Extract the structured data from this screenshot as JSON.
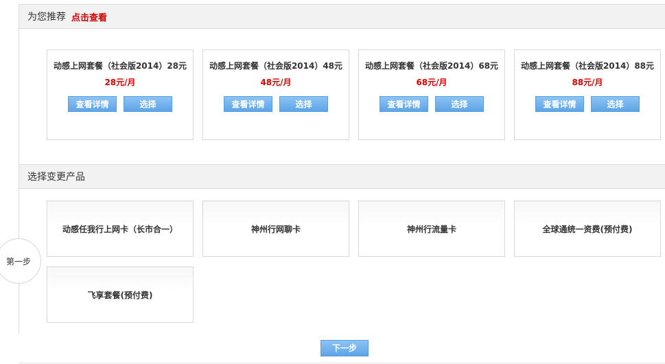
{
  "recommend": {
    "title": "为您推荐",
    "link": "点击查看",
    "plans": [
      {
        "name": "动感上网套餐（社会版2014）28元",
        "price": "28元/月",
        "detail": "查看详情",
        "select": "选择"
      },
      {
        "name": "动感上网套餐（社会版2014）48元",
        "price": "48元/月",
        "detail": "查看详情",
        "select": "选择"
      },
      {
        "name": "动感上网套餐（社会版2014）68元",
        "price": "68元/月",
        "detail": "查看详情",
        "select": "选择"
      },
      {
        "name": "动感上网套餐（社会版2014）88元",
        "price": "88元/月",
        "detail": "查看详情",
        "select": "选择"
      }
    ]
  },
  "products": {
    "title": "选择变更产品",
    "items": [
      "动感任我行上网卡（长市合一）",
      "神州行网聊卡",
      "神州行流量卡",
      "全球通统一资费(预付费)",
      "飞享套餐(预付费)"
    ]
  },
  "step": {
    "label": "第一步"
  },
  "next_button": "下一步",
  "colors": {
    "price": "#d40000",
    "link": "#cc0000",
    "button": "#6aace9"
  }
}
